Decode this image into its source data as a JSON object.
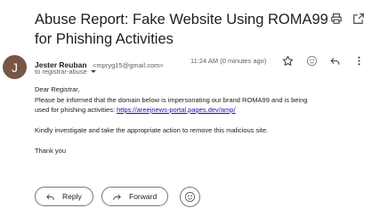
{
  "email": {
    "subject": "Abuse Report: Fake Website Using ROMA99 for Phishing Activities",
    "sender": {
      "avatar_initial": "J",
      "avatar_color": "#795548",
      "name": "Jester Reuban",
      "email": "<mpryg15@gmail.com>",
      "to": "to registrar-abuse"
    },
    "timestamp": "11:24 AM (0 minutes ago)",
    "body": {
      "greeting": "Dear Registrar,",
      "line1": "Please be informed that the domain below is impersonating our brand ROMA99 and is being",
      "line2_prefix": "used for phishing activities: ",
      "link": "https://areejnews-portal.pages.dev/amp/",
      "line3": "Kindly investigate and take the appropriate action to remove this malicious site.",
      "signoff": "Thank you"
    }
  },
  "actions": {
    "reply_label": "Reply",
    "forward_label": "Forward"
  },
  "icons": {
    "print": "print-icon",
    "open_new_window": "open-in-new-icon",
    "star": "star-icon",
    "emoji": "emoji-icon",
    "reply": "reply-icon",
    "more": "more-vert-icon",
    "forward": "forward-icon"
  }
}
